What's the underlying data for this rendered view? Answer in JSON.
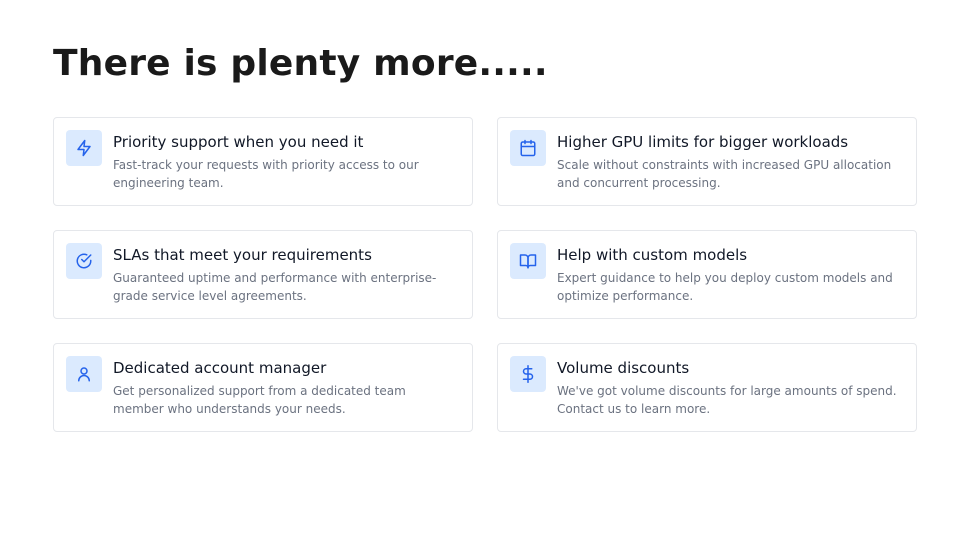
{
  "page": {
    "title": "There is plenty more....."
  },
  "features": [
    {
      "icon": "lightning-bolt-icon",
      "title": "Priority support when you need it",
      "description": "Fast-track your requests with priority access to our engineering team."
    },
    {
      "icon": "calendar-icon",
      "title": "Higher GPU limits for bigger workloads",
      "description": "Scale without constraints with increased GPU allocation and concurrent processing."
    },
    {
      "icon": "check-circle-icon",
      "title": "SLAs that meet your requirements",
      "description": "Guaranteed uptime and performance with enterprise-grade service level agreements."
    },
    {
      "icon": "book-open-icon",
      "title": "Help with custom models",
      "description": "Expert guidance to help you deploy custom models and optimize performance."
    },
    {
      "icon": "user-icon",
      "title": "Dedicated account manager",
      "description": "Get personalized support from a dedicated team member who understands your needs."
    },
    {
      "icon": "dollar-sign-icon",
      "title": "Volume discounts",
      "description": "We've got volume discounts for large amounts of spend. Contact us to learn more."
    }
  ],
  "colors": {
    "icon_background": "#dbeafe",
    "icon_stroke": "#2563eb",
    "card_border": "#e5e7eb",
    "description_text": "#6b7280"
  }
}
